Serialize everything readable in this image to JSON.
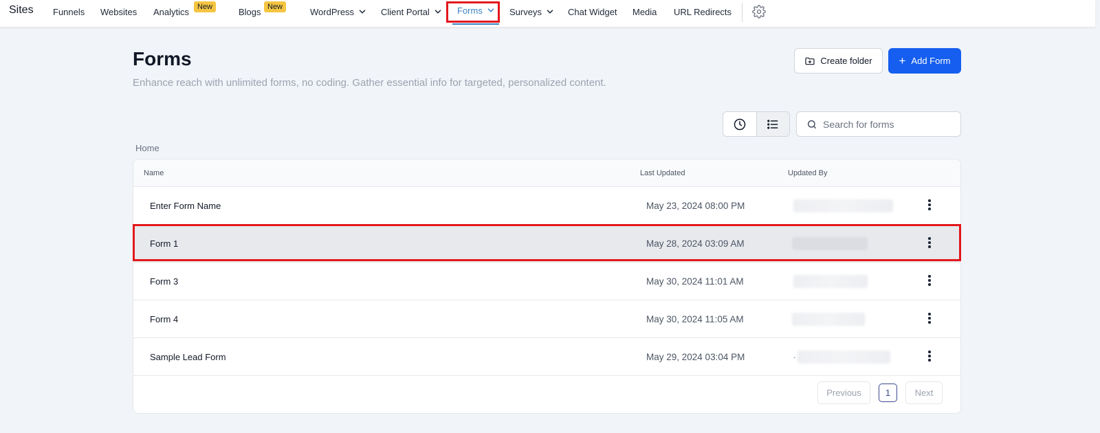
{
  "nav": {
    "brand": "Sites",
    "items": [
      {
        "key": "funnels",
        "label": "Funnels"
      },
      {
        "key": "websites",
        "label": "Websites"
      },
      {
        "key": "analytics",
        "label": "Analytics",
        "badge": "New"
      },
      {
        "key": "blogs",
        "label": "Blogs",
        "badge": "New"
      },
      {
        "key": "wordpress",
        "label": "WordPress"
      },
      {
        "key": "client-portal",
        "label": "Client Portal"
      },
      {
        "key": "forms",
        "label": "Forms",
        "active": true
      },
      {
        "key": "surveys",
        "label": "Surveys"
      },
      {
        "key": "chat-widget",
        "label": "Chat Widget"
      },
      {
        "key": "media",
        "label": "Media"
      },
      {
        "key": "url-redirects",
        "label": "URL Redirects"
      }
    ],
    "icons": {
      "dropdown": "chevron-down-icon",
      "settings": "gear-icon"
    },
    "accent_color": "#3b82c4",
    "highlight_color": "#e3171c"
  },
  "header": {
    "title": "Forms",
    "subtitle": "Enhance reach with unlimited forms, no coding. Gather essential info for targeted, personalized content.",
    "create_folder_label": "Create folder",
    "add_form_label": "Add Form",
    "primary_color": "#155eef"
  },
  "toolbar": {
    "view_modes": [
      "recent",
      "list"
    ],
    "active_view": "list",
    "search_placeholder": "Search for forms",
    "search_value": ""
  },
  "breadcrumb": "Home",
  "table": {
    "columns": [
      "Name",
      "Last Updated",
      "Updated By"
    ],
    "rows": [
      {
        "name": "Enter Form Name",
        "last_updated": "May 23, 2024 08:00 PM",
        "updated_by": "",
        "selected": false
      },
      {
        "name": "Form 1",
        "last_updated": "May 28, 2024 03:09 AM",
        "updated_by": "",
        "selected": true
      },
      {
        "name": "Form 3",
        "last_updated": "May 30, 2024 11:01 AM",
        "updated_by": "",
        "selected": false
      },
      {
        "name": "Form 4",
        "last_updated": "May 30, 2024 11:05 AM",
        "updated_by": "",
        "selected": false
      },
      {
        "name": "Sample Lead Form",
        "last_updated": "May 29, 2024 03:04 PM",
        "updated_by": ".",
        "selected": false
      }
    ]
  },
  "pagination": {
    "previous_label": "Previous",
    "current_page": "1",
    "next_label": "Next"
  }
}
